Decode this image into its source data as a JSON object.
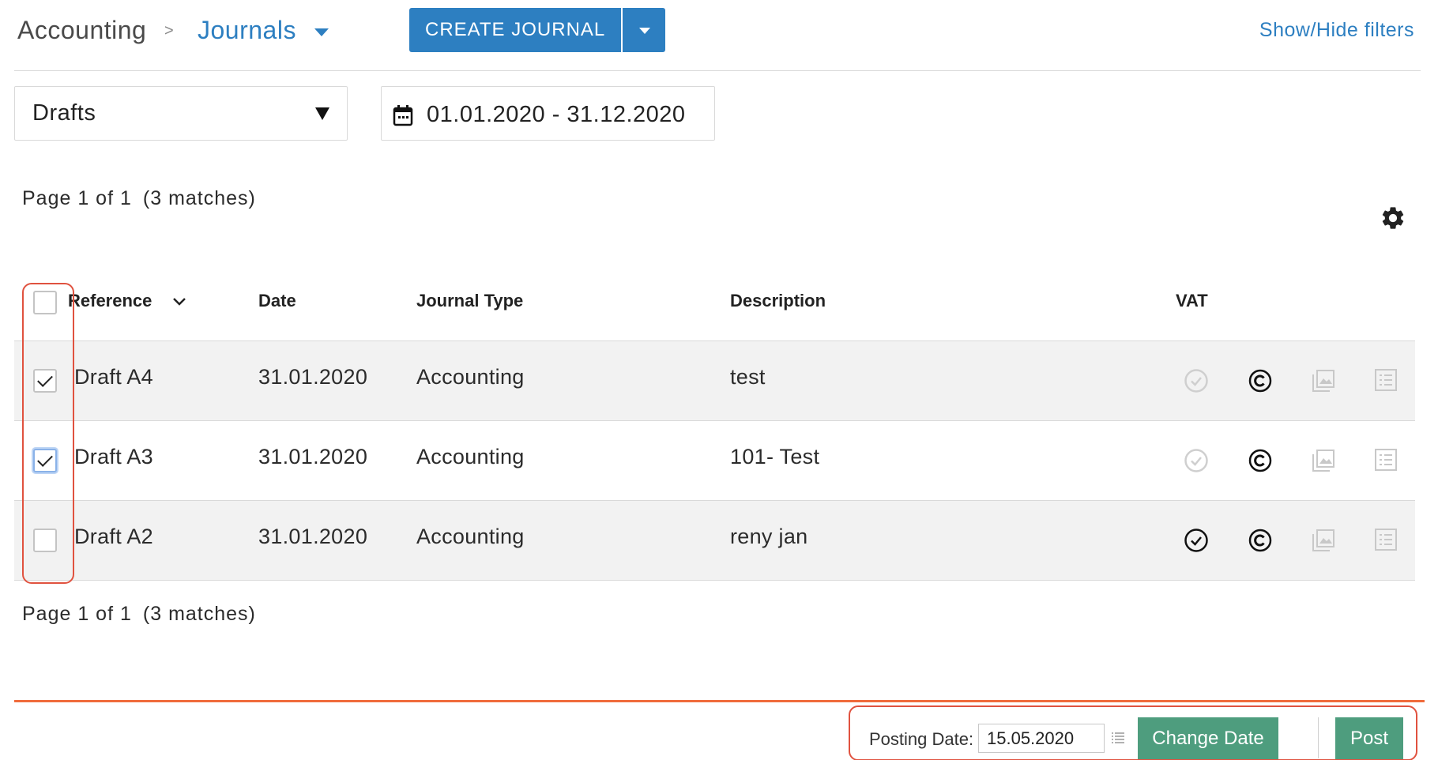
{
  "breadcrumb": {
    "root": "Accounting",
    "separator": ">",
    "current": "Journals"
  },
  "header": {
    "create_button": "CREATE JOURNAL",
    "filters_link": "Show/Hide filters"
  },
  "filters": {
    "status": "Drafts",
    "date_range": "01.01.2020 - 31.12.2020"
  },
  "pagination": {
    "page": "Page 1 of 1",
    "matches": "(3 matches)"
  },
  "table": {
    "columns": {
      "reference": "Reference",
      "date": "Date",
      "journal_type": "Journal Type",
      "description": "Description",
      "vat": "VAT"
    },
    "rows": [
      {
        "reference": "Draft A4",
        "date": "31.01.2020",
        "journal_type": "Accounting",
        "description": "test",
        "checked": true,
        "vat_done": false
      },
      {
        "reference": "Draft A3",
        "date": "31.01.2020",
        "journal_type": "Accounting",
        "description": "101- Test",
        "checked": true,
        "vat_done": false
      },
      {
        "reference": "Draft A2",
        "date": "31.01.2020",
        "journal_type": "Accounting",
        "description": "reny jan",
        "checked": false,
        "vat_done": true
      }
    ]
  },
  "footer": {
    "posting_date_label": "Posting Date:",
    "posting_date_value": "15.05.2020",
    "change_date_button": "Change Date",
    "post_button": "Post"
  },
  "icons": {
    "calendar": "calendar-icon",
    "gear": "gear-icon",
    "vat": "check-circle-icon",
    "copyright": "copyright-icon",
    "image": "image-icon",
    "list": "list-icon"
  },
  "colors": {
    "accent": "#2d7fc1",
    "action_green": "#4e9d7e",
    "highlight_red": "#e0523f",
    "footer_orange": "#f06b3c"
  }
}
